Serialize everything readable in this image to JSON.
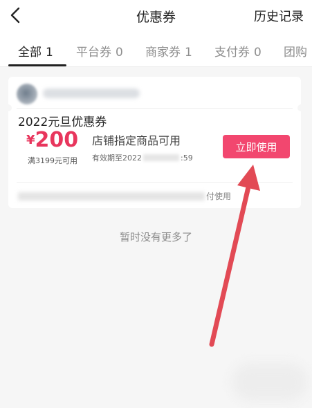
{
  "header": {
    "title": "优惠券",
    "history_label": "历史记录"
  },
  "tabs": [
    {
      "label": "全部",
      "count": "1"
    },
    {
      "label": "平台券",
      "count": "0"
    },
    {
      "label": "商家券",
      "count": "1"
    },
    {
      "label": "支付券",
      "count": "0"
    },
    {
      "label": "团购",
      "count": ""
    }
  ],
  "coupon": {
    "name": "2022元旦优惠券",
    "currency": "¥",
    "amount": "200",
    "threshold": "满3199元可用",
    "scope": "店铺指定商品可用",
    "validity_prefix": "有效期至2022",
    "validity_suffix": ":59",
    "use_button": "立即使用",
    "rule_suffix": "付使用"
  },
  "footer": {
    "no_more": "暂时没有更多了"
  },
  "colors": {
    "accent": "#f2476f",
    "price": "#e8365d",
    "arrow": "#e24a55"
  },
  "icons": {
    "back": "chevron-left-icon",
    "arrow": "arrow-annotation-icon"
  }
}
